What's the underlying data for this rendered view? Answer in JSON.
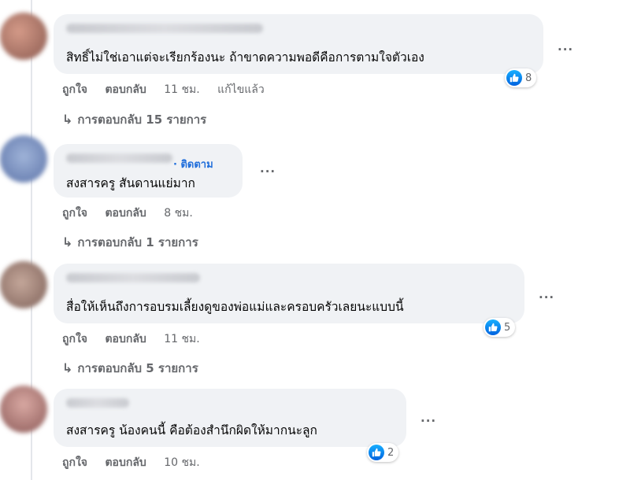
{
  "comments": [
    {
      "text": "สิทธิ์ไม่ใช่เอาแต่จะเรียกร้องนะ ถ้าขาดความพอดีคือการตามใจตัวเอง",
      "more": "...",
      "reaction_count": "8",
      "like_label": "ถูกใจ",
      "reply_label": "ตอบกลับ",
      "time": "11 ชม.",
      "edited": "แก้ไขแล้ว",
      "replies_label": "การตอบกลับ 15 รายการ"
    },
    {
      "follow": "· ติดตาม",
      "text": "สงสารครู สันดานแย่มาก",
      "more": "...",
      "like_label": "ถูกใจ",
      "reply_label": "ตอบกลับ",
      "time": "8 ชม.",
      "replies_label": "การตอบกลับ 1 รายการ"
    },
    {
      "text": "สื่อให้เห็นถึงการอบรมเลี้ยงดูของพ่อแม่และครอบครัวเลยนะแบบนี้",
      "more": "...",
      "reaction_count": "5",
      "like_label": "ถูกใจ",
      "reply_label": "ตอบกลับ",
      "time": "11 ชม.",
      "replies_label": "การตอบกลับ 5 รายการ"
    },
    {
      "text": "สงสารครู น้องคนนี้ คือต้องสำนึกผิดให้มากนะลูก",
      "more": "...",
      "reaction_count": "2",
      "like_label": "ถูกใจ",
      "reply_label": "ตอบกลับ",
      "time": "10 ชม."
    }
  ],
  "reply_arrow_icon": "reply-arrow-icon",
  "like_reaction_icon": "thumbs-up-icon",
  "colors": {
    "bubble": "#f0f2f5",
    "link": "#216fdb",
    "muted": "#65676b",
    "like": "#0a7cff"
  }
}
